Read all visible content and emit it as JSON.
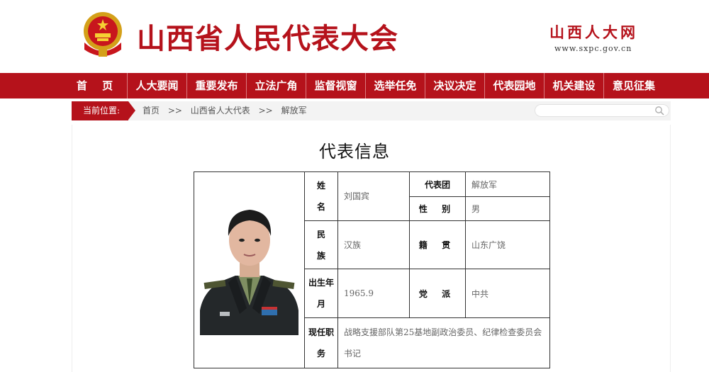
{
  "header": {
    "title": "山西省人民代表大会",
    "brand": "山西人大网",
    "domain": "www.sxpc.gov.cn"
  },
  "nav": [
    "首 页",
    "人大要闻",
    "重要发布",
    "立法广角",
    "监督视窗",
    "选举任免",
    "决议决定",
    "代表园地",
    "机关建设",
    "意见征集"
  ],
  "breadcrumb": {
    "label": "当前位置:",
    "items": [
      "首页",
      ">>",
      "山西省人大代表",
      ">>",
      "解放军"
    ]
  },
  "search": {
    "placeholder": ""
  },
  "page_title": "代表信息",
  "profile": {
    "name_label_1": "姓",
    "name_label_2": "名",
    "name": "刘国宾",
    "delegation_label": "代表团",
    "delegation": "解放军",
    "gender_label": "性 别",
    "gender": "男",
    "ethnicity_label_1": "民",
    "ethnicity_label_2": "族",
    "ethnicity": "汉族",
    "origin_label": "籍 贯",
    "origin": "山东广饶",
    "birth_label_1": "出生年",
    "birth_label_2": "月",
    "birth": "1965.9",
    "party_label": "党 派",
    "party": "中共",
    "position_label_1": "现任职",
    "position_label_2": "务",
    "position": "战略支援部队第25基地副政治委员、纪律检查委员会书记"
  },
  "colors": {
    "brand_red": "#b5121b"
  }
}
